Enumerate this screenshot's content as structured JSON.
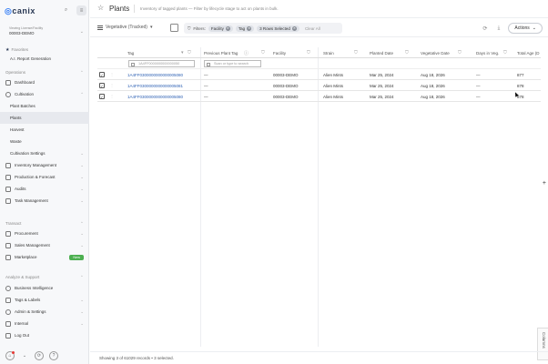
{
  "app": {
    "logo_text": "canix",
    "license_label": "Viewing License/Facility",
    "license_value": "00003-DEMO"
  },
  "sidebar": {
    "favorites_label": "Favorites",
    "favorites": [
      "A.I. Report Generation"
    ],
    "operations_label": "Operations",
    "items": [
      {
        "label": "Dashboard"
      },
      {
        "label": "Cultivation"
      }
    ],
    "cultivation_sub": [
      "Plant Batches",
      "Plants",
      "Harvest",
      "Waste",
      "Cultivation Settings"
    ],
    "more_items": [
      "Inventory Management",
      "Production & Forecast",
      "Audits",
      "Task Management"
    ],
    "transact_label": "Transact",
    "transact_items": [
      "Procurement",
      "Sales Management",
      "Marketplace"
    ],
    "marketplace_badge": "New",
    "analyze_label": "Analyze & Support",
    "analyze_items": [
      "Business Intelligence",
      "Tags & Labels",
      "Admin & Settings",
      "Internal",
      "Log Out"
    ]
  },
  "header": {
    "title": "Plants",
    "description": "Inventory of tagged plants — Filter by lifecycle stage to act on plants in bulk."
  },
  "toolbar": {
    "view_label": "Vegetative (Tracked)",
    "filters_label": "Filters:",
    "chips": [
      "Facility",
      "Tag",
      "3 Rows Selected"
    ],
    "clear_all": "Clear All",
    "actions_label": "Actions"
  },
  "grid": {
    "columns": [
      "Tag",
      "Previous Plant Tag",
      "Facility",
      "Strain",
      "Planted Date",
      "Vegetative Date",
      "Days in Veg.",
      "Total Age (D"
    ],
    "tag_filter_value": "1A4FF0000000000000050",
    "prev_filter_placeholder": "Scan or type to search",
    "rows": [
      {
        "tag": "1A4FF0300000000000005080",
        "prev": "—",
        "facility": "00003-DEMO",
        "strain": "Alien Mints",
        "planted": "Mar 25, 2024",
        "veg": "Aug 18, 2026",
        "days": "—",
        "age": "877"
      },
      {
        "tag": "1A4FF0300000000000005081",
        "prev": "—",
        "facility": "00003-DEMO",
        "strain": "Alien Mints",
        "planted": "Mar 25, 2024",
        "veg": "Aug 18, 2026",
        "days": "—",
        "age": "878"
      },
      {
        "tag": "1A4FF0300000000000005080",
        "prev": "—",
        "facility": "00003-DEMO",
        "strain": "Alien Mints",
        "planted": "Mar 25, 2024",
        "veg": "Aug 18, 2026",
        "days": "—",
        "age": "878"
      }
    ]
  },
  "footer": {
    "status": "Showing 3 of 61029 records • 3 selected."
  },
  "columns_tab_label": "Columns"
}
